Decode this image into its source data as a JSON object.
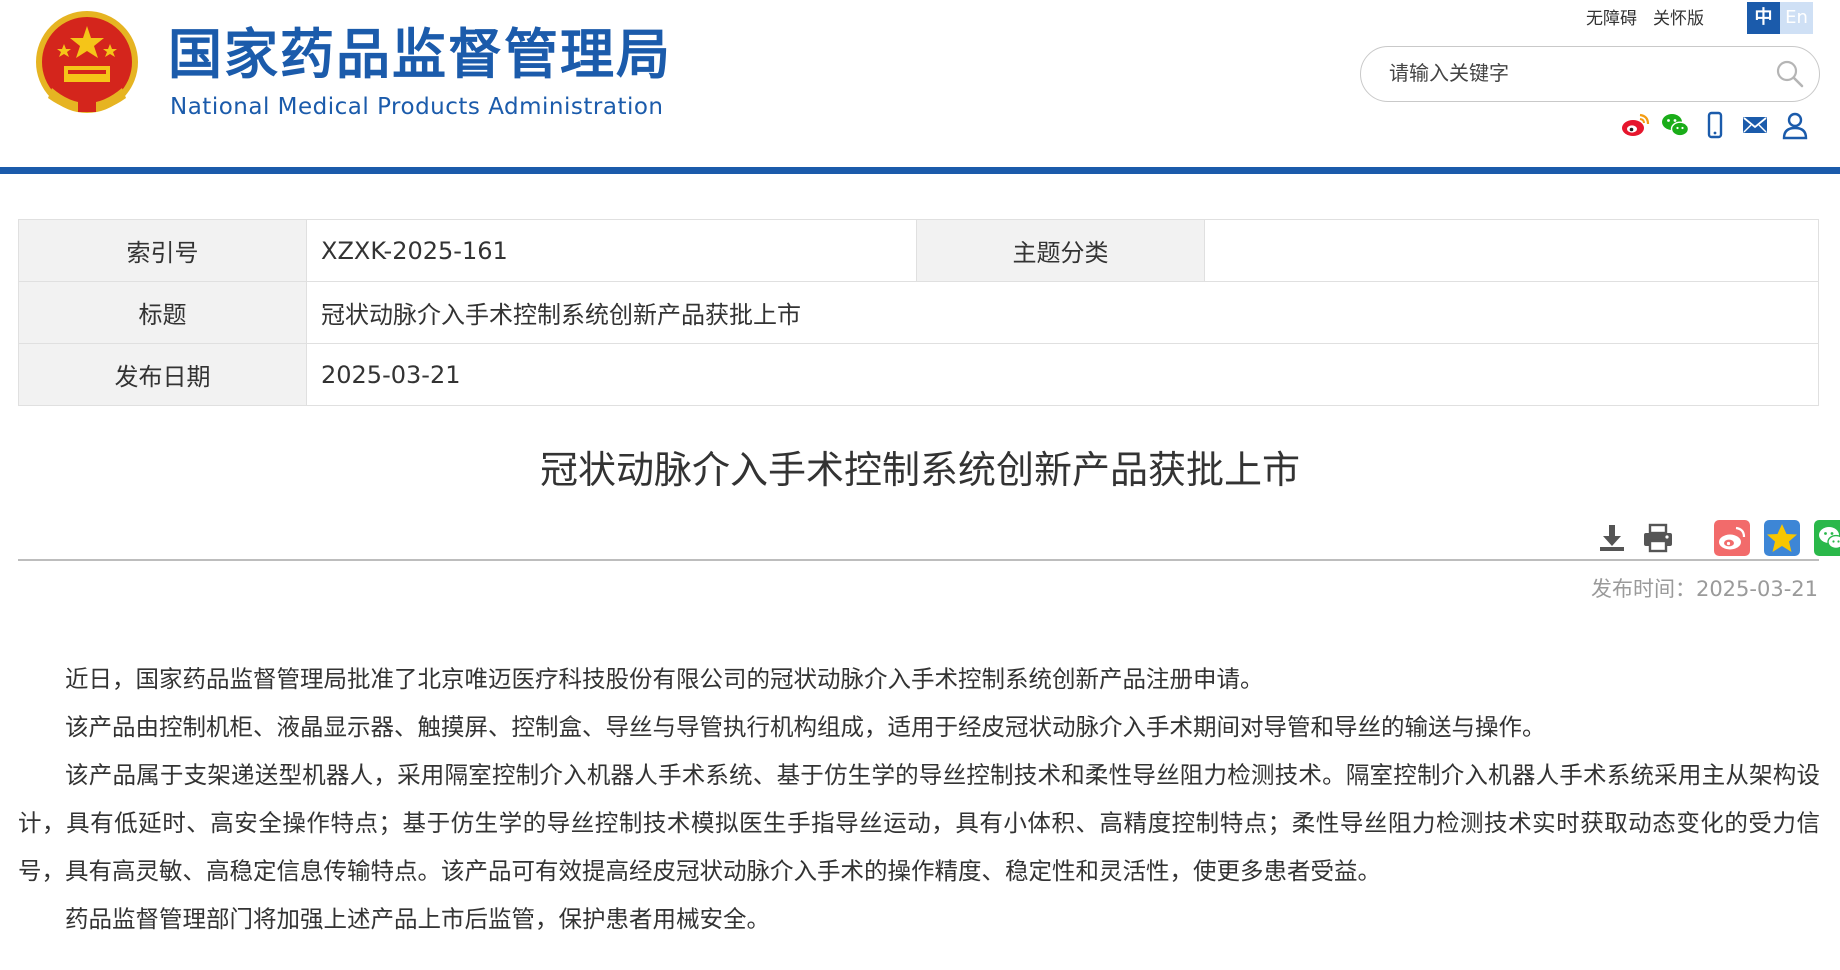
{
  "header": {
    "brand_cn": "国家药品监督管理局",
    "brand_en": "National Medical Products Administration",
    "toplinks": [
      "无障碍",
      "关怀版"
    ],
    "lang_cn": "中",
    "lang_en": "En",
    "search_placeholder": "请输入关键字",
    "brand_color": "#1b5bab",
    "social_icons": [
      "weibo-icon",
      "wechat-icon",
      "mobile-icon",
      "mail-icon",
      "user-icon"
    ]
  },
  "info_table": {
    "index_label": "索引号",
    "index_value": "XZXK-2025-161",
    "topic_label": "主题分类",
    "topic_value": "",
    "title_label": "标题",
    "title_value": "冠状动脉介入手术控制系统创新产品获批上市",
    "date_label": "发布日期",
    "date_value": "2025-03-21"
  },
  "article": {
    "title": "冠状动脉介入手术控制系统创新产品获批上市",
    "pubtime_label": "发布时间：",
    "pubtime_value": "2025-03-21",
    "tools": [
      "download-icon",
      "print-icon",
      "weibo-share-icon",
      "qzone-share-icon",
      "wechat-share-icon"
    ],
    "paragraphs": [
      "近日，国家药品监督管理局批准了北京唯迈医疗科技股份有限公司的冠状动脉介入手术控制系统创新产品注册申请。",
      "该产品由控制机柜、液晶显示器、触摸屏、控制盒、导丝与导管执行机构组成，适用于经皮冠状动脉介入手术期间对导管和导丝的输送与操作。",
      "该产品属于支架递送型机器人，采用隔室控制介入机器人手术系统、基于仿生学的导丝控制技术和柔性导丝阻力检测技术。隔室控制介入机器人手术系统采用主从架构设计，具有低延时、高安全操作特点；基于仿生学的导丝控制技术模拟医生手指导丝运动，具有小体积、高精度控制特点；柔性导丝阻力检测技术实时获取动态变化的受力信号，具有高灵敏、高稳定信息传输特点。该产品可有效提高经皮冠状动脉介入手术的操作精度、稳定性和灵活性，使更多患者受益。",
      "药品监督管理部门将加强上述产品上市后监管，保护患者用械安全。"
    ]
  }
}
